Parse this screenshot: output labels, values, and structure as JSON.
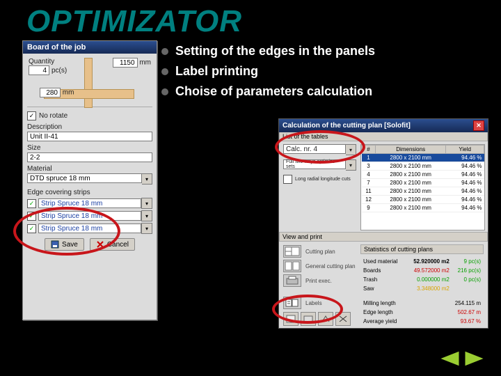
{
  "title": "OPTIMIZATOR",
  "bullets": [
    "Setting of the edges in the panels",
    "Label printing",
    "Choise of parameters calculation"
  ],
  "panel1": {
    "titlebar": "Board of the job",
    "qty_label": "Quantity",
    "qty_value": "4",
    "qty_unit": "pc(s)",
    "dim_width": "1150",
    "dim_width_unit": "mm",
    "dim_height": "280",
    "dim_height_unit": "mm",
    "norotate": "No rotate",
    "desc_label": "Description",
    "desc_value": "Unit II-41",
    "size_label": "Size",
    "size_value": "2-2",
    "material_label": "Material",
    "material_value": "DTD spruce 18 mm",
    "edges_label": "Edge covering strips",
    "strips": [
      "Strip Spruce 18 mm",
      "Strip Spruce 18 mm",
      "Strip Spruce 18 mm"
    ],
    "save": "Save",
    "cancel": "Cancel"
  },
  "panel2": {
    "titlebar": "Calculation of the cutting plan  [Solofit]",
    "tables_label": "List of the tables",
    "calc_select": "Calc. nr. 4",
    "optimize_label": "Full two-ways optimize sets",
    "longcut_label": "Long radial longitude cuts",
    "table": {
      "cols": [
        "#",
        "Dimensions",
        "Yield"
      ],
      "rows": [
        [
          "1",
          "2800 x 2100 mm",
          "94.46 %"
        ],
        [
          "3",
          "2800 x 2100 mm",
          "94.46 %"
        ],
        [
          "4",
          "2800 x 2100 mm",
          "94.46 %"
        ],
        [
          "7",
          "2800 x 2100 mm",
          "94.46 %"
        ],
        [
          "11",
          "2800 x 2100 mm",
          "94.46 %"
        ],
        [
          "12",
          "2800 x 2100 mm",
          "94.46 %"
        ],
        [
          "9",
          "2800 x 2100 mm",
          "94.46 %"
        ]
      ]
    },
    "view_label": "View and print",
    "tools": [
      {
        "name": "cutting-plan",
        "label": "Cutting plan"
      },
      {
        "name": "general-plan",
        "label": "General cutting plan"
      },
      {
        "name": "print-exe",
        "label": "Print exec."
      },
      {
        "name": "labels",
        "label": "Labels"
      }
    ],
    "stats_title": "Statistics of cutting plans",
    "stats": {
      "used_material_k": "Used material",
      "used_material_v": "52.920000 m2",
      "used_material_u": "9 pc(s)",
      "boards_k": "Boards",
      "boards_v": "49.572000 m2",
      "boards_u": "216 pc(s)",
      "trash_k": "Trash",
      "trash_v": "0.000000 m2",
      "trash_u": "0 pc(s)",
      "saw_k": "Saw",
      "saw_v": "3.348000 m2",
      "mill_k": "Milling length",
      "mill_v": "254.115 m",
      "edge_k": "Edge length",
      "edge_v": "502.67 m",
      "auto_k": "Average yield",
      "auto_v": "93.67 %"
    }
  }
}
